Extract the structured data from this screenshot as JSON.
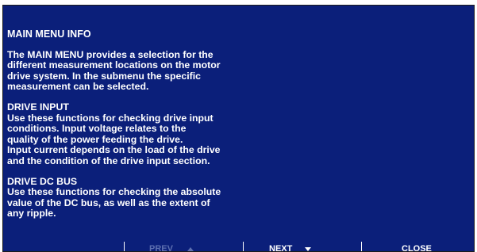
{
  "info": {
    "title": "MAIN MENU INFO",
    "intro_lines": [
      "The MAIN MENU provides a selection for the",
      "different measurement locations on the motor",
      "drive system. In the submenu the specific",
      "measurement can be selected."
    ],
    "sections": [
      {
        "title": "DRIVE INPUT",
        "lines": [
          "Use these functions for checking drive input",
          "conditions. Input voltage relates to the",
          "quality of the power feeding the drive.",
          "Input current depends on the load of the drive",
          "and the condition of the drive input section."
        ]
      },
      {
        "title": "DRIVE DC BUS",
        "lines": [
          "Use these functions for checking the absolute",
          "value of the DC bus, as well as the extent of",
          "any ripple."
        ]
      }
    ]
  },
  "footer": {
    "prev_label": "PREV",
    "next_label": "NEXT",
    "close_label": "CLOSE",
    "prev_icon": "chevron-up-icon",
    "next_icon": "chevron-down-icon"
  },
  "colors": {
    "background": "#0b1f7a",
    "text": "#ffffff",
    "disabled_text": "#5d6fb0"
  }
}
